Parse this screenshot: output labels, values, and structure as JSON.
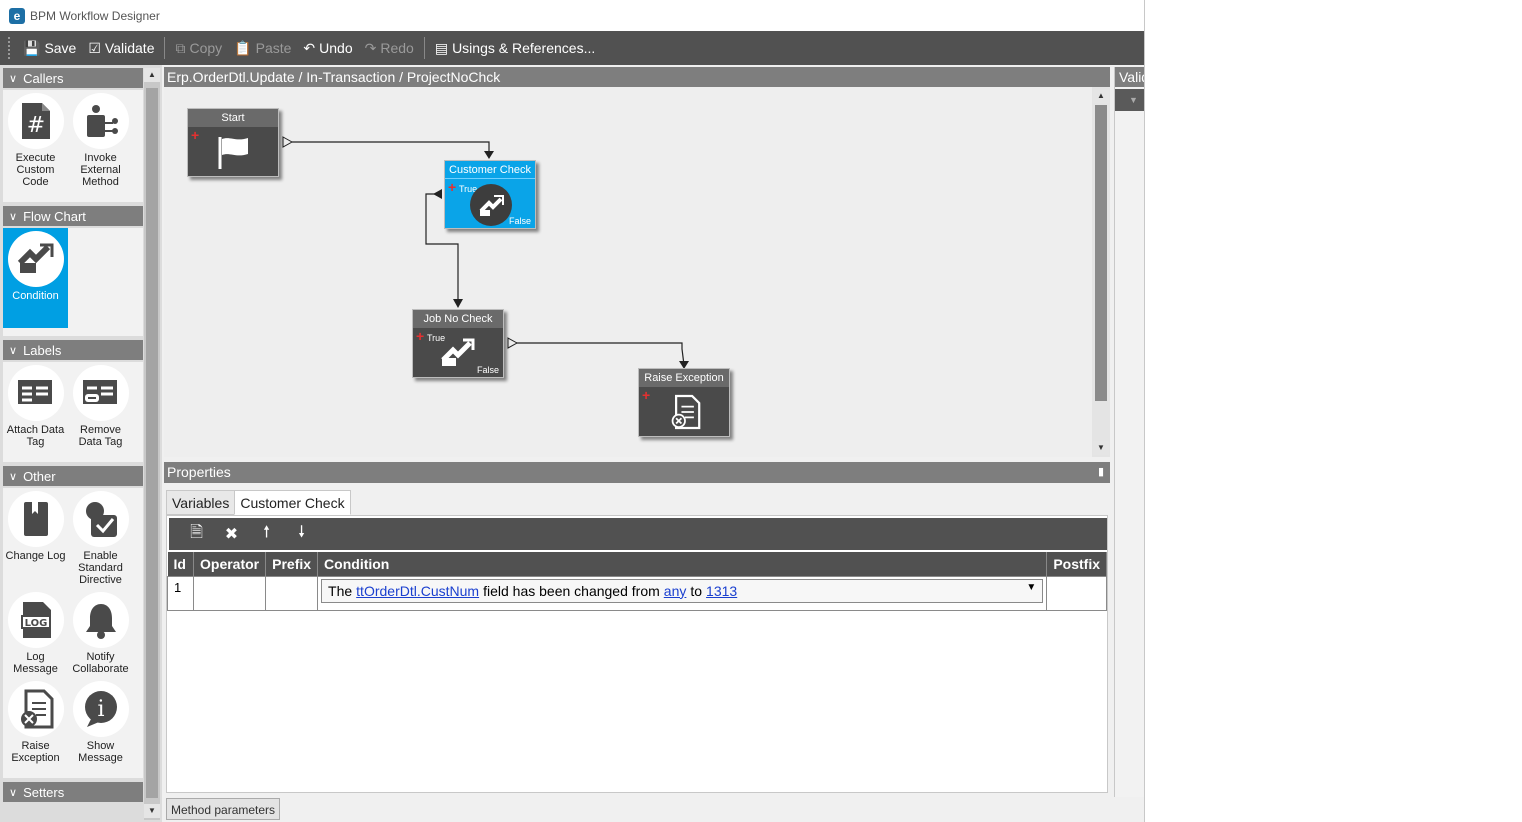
{
  "window": {
    "title": "BPM Workflow Designer"
  },
  "toolbar": {
    "save": "Save",
    "validate": "Validate",
    "copy": "Copy",
    "paste": "Paste",
    "undo": "Undo",
    "redo": "Redo",
    "usings": "Usings & References..."
  },
  "toolbox": {
    "sections": [
      {
        "title": "Callers",
        "items": [
          "Execute Custom Code",
          "Invoke External Method"
        ]
      },
      {
        "title": "Flow Chart",
        "items": [
          "Condition"
        ],
        "selected": "Condition"
      },
      {
        "title": "Labels",
        "items": [
          "Attach Data Tag",
          "Remove Data Tag"
        ]
      },
      {
        "title": "Other",
        "items": [
          "Change Log",
          "Enable Standard Directive",
          "Log Message",
          "Notify Collaborate",
          "Raise Exception",
          "Show Message"
        ]
      },
      {
        "title": "Setters",
        "items": []
      }
    ]
  },
  "canvas": {
    "breadcrumb": "Erp.OrderDtl.Update / In-Transaction / ProjectNoChck",
    "nodes": {
      "start": {
        "title": "Start"
      },
      "customer_check": {
        "title": "Customer Check",
        "true_label": "True",
        "false_label": "False"
      },
      "job_no_check": {
        "title": "Job No Check",
        "true_label": "True",
        "false_label": "False"
      },
      "raise_exception": {
        "title": "Raise Exception"
      }
    }
  },
  "validation_panel": {
    "title": "Validation"
  },
  "properties": {
    "title": "Properties",
    "tabs": [
      "Variables",
      "Customer Check"
    ],
    "active_tab": "Customer Check",
    "grid": {
      "columns": [
        "Id",
        "Operator",
        "Prefix",
        "Condition",
        "Postfix"
      ],
      "rows": [
        {
          "id": "1",
          "operator": "",
          "prefix": "",
          "condition": {
            "t1": "The",
            "field": "ttOrderDtl.CustNum",
            "t2": "field has been changed from",
            "from": "any",
            "t3": "to",
            "to": "1313"
          },
          "postfix": ""
        }
      ]
    }
  },
  "bottom_tab": "Method parameters",
  "colors": {
    "accent": "#0aa4e8",
    "toolbar": "#515151",
    "header": "#7e7e7e"
  }
}
